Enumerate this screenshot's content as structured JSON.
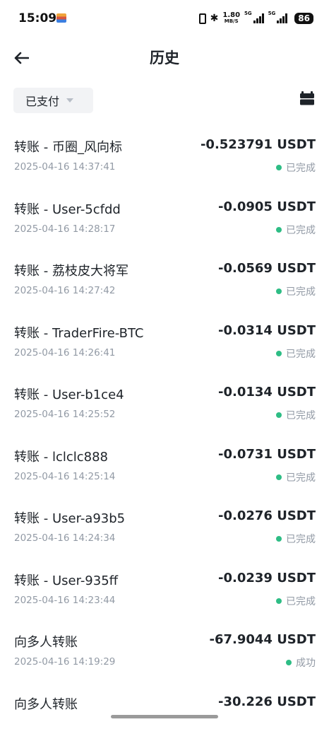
{
  "status_bar": {
    "time": "15:09",
    "net_speed_value": "1.80",
    "net_speed_unit": "MB/S",
    "net_type_1": "5G",
    "net_type_2": "5G",
    "battery": "86"
  },
  "header": {
    "title": "历史"
  },
  "filter": {
    "label": "已支付"
  },
  "transactions": [
    {
      "title": "转账 - 币圈_风向标",
      "amount": "-0.523791 USDT",
      "date": "2025-04-16 14:37:41",
      "status": "已完成"
    },
    {
      "title": "转账 - User-5cfdd",
      "amount": "-0.0905 USDT",
      "date": "2025-04-16 14:28:17",
      "status": "已完成"
    },
    {
      "title": "转账 - 荔枝皮大将军",
      "amount": "-0.0569 USDT",
      "date": "2025-04-16 14:27:42",
      "status": "已完成"
    },
    {
      "title": "转账 - TraderFire-BTC",
      "amount": "-0.0314 USDT",
      "date": "2025-04-16 14:26:41",
      "status": "已完成"
    },
    {
      "title": "转账 - User-b1ce4",
      "amount": "-0.0134 USDT",
      "date": "2025-04-16 14:25:52",
      "status": "已完成"
    },
    {
      "title": "转账 - lclclc888",
      "amount": "-0.0731 USDT",
      "date": "2025-04-16 14:25:14",
      "status": "已完成"
    },
    {
      "title": "转账 - User-a93b5",
      "amount": "-0.0276 USDT",
      "date": "2025-04-16 14:24:34",
      "status": "已完成"
    },
    {
      "title": "转账 - User-935ff",
      "amount": "-0.0239 USDT",
      "date": "2025-04-16 14:23:44",
      "status": "已完成"
    },
    {
      "title": "向多人转账",
      "amount": "-67.9044 USDT",
      "date": "2025-04-16 14:19:29",
      "status": "成功"
    },
    {
      "title": "向多人转账",
      "amount": "-30.226 USDT",
      "date": "",
      "status": ""
    }
  ],
  "colors": {
    "status_success": "#2ebd85",
    "text_primary": "#1e2329",
    "text_secondary": "#929aa5",
    "chip_bg": "#f2f3f5"
  }
}
